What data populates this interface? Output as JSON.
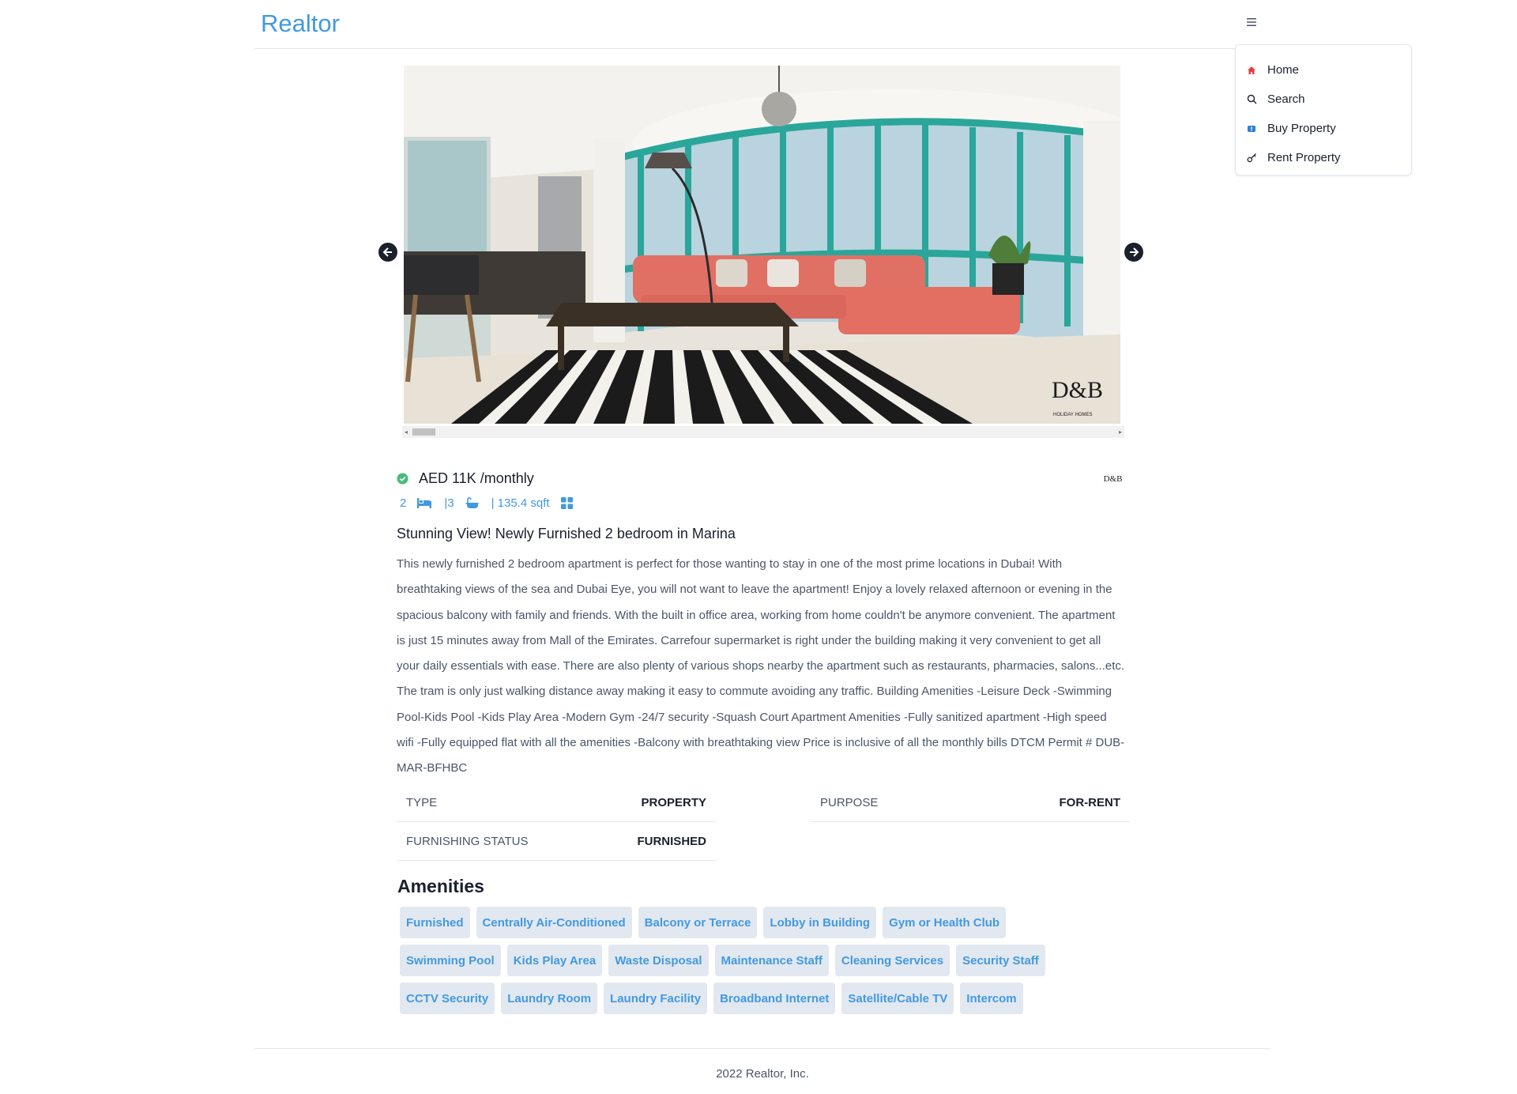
{
  "navbar": {
    "brand": "Realtor",
    "menu_icon": "hamburger-icon",
    "menu": [
      {
        "label": "Home",
        "icon": "home-icon",
        "color": "#e53e3e"
      },
      {
        "label": "Search",
        "icon": "search-icon",
        "color": "#1a202c"
      },
      {
        "label": "Buy Property",
        "icon": "buy-property-icon",
        "color": "#3182ce"
      },
      {
        "label": "Rent Property",
        "icon": "key-icon",
        "color": "#1a202c"
      }
    ]
  },
  "carousel": {
    "watermark_title": "D&B",
    "watermark_subtitle": "HOLIDAY HOMES"
  },
  "listing": {
    "price": "AED 11K /monthly",
    "verified_icon": "check-circle-icon",
    "agency_logo_text": "D&B",
    "rooms": "2",
    "baths": "|3",
    "area": "| 135.4 sqft",
    "title": "Stunning View! Newly Furnished 2 bedroom in Marina",
    "description": "This newly furnished 2 bedroom apartment is perfect for those wanting to stay in one of the most prime locations in Dubai! With breathtaking views of the sea and Dubai Eye, you will not want to leave the apartment! Enjoy a lovely relaxed afternoon or evening in the spacious balcony with family and friends. With the built in office area, working from home couldn't be anymore convenient. The apartment is just 15 minutes away from Mall of the Emirates. Carrefour supermarket is right under the building making it very convenient to get all your daily essentials with ease. There are also plenty of various shops nearby the apartment such as restaurants, pharmacies, salons...etc. The tram is only just walking distance away making it easy to commute avoiding any traffic. Building Amenities -Leisure Deck -Swimming Pool-Kids Pool -Kids Play Area -Modern Gym -24/7 security -Squash Court Apartment Amenities -Fully sanitized apartment -High speed wifi -Fully equipped flat with all the amenities -Balcony with breathtaking view Price is inclusive of all the monthly bills DTCM Permit # DUB-MAR-BFHBC",
    "properties": {
      "type_label": "TYPE",
      "type_value": "PROPERTY",
      "purpose_label": "PURPOSE",
      "purpose_value": "FOR-RENT",
      "furnishing_label": "FURNISHING STATUS",
      "furnishing_value": "FURNISHED"
    },
    "amenities_title": "Amenities",
    "amenities": [
      [
        "Furnished",
        "Centrally Air-Conditioned",
        "Balcony or Terrace",
        "Lobby in Building",
        "Gym or Health Club"
      ],
      [
        "Swimming Pool",
        "Kids Play Area",
        "Waste Disposal",
        "Maintenance Staff",
        "Cleaning Services",
        "Security Staff"
      ],
      [
        "CCTV Security",
        "Laundry Room",
        "Laundry Facility",
        "Broadband Internet",
        "Satellite/Cable TV",
        "Intercom"
      ]
    ]
  },
  "footer": {
    "text": "2022 Realtor, Inc."
  },
  "colors": {
    "accent": "#4299e1",
    "verified": "#48bb78",
    "tag_bg": "#e2e8f0"
  }
}
